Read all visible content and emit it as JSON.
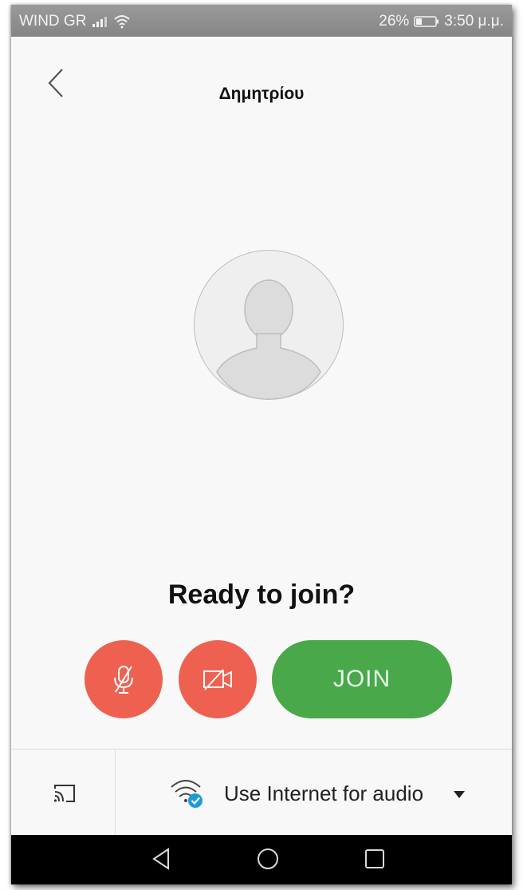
{
  "status_bar": {
    "carrier": "WIND GR",
    "battery_percent": "26%",
    "time": "3:50 μ.μ."
  },
  "header": {
    "title": "Δημητρίου",
    "back_icon": "chevron-left-icon"
  },
  "avatar": {
    "icon": "person-silhouette-icon"
  },
  "main": {
    "heading": "Ready to join?",
    "mute_icon": "microphone-off-icon",
    "video_icon": "video-off-icon",
    "join_label": "JOIN"
  },
  "bottom_bar": {
    "cast_icon": "cast-icon",
    "audio_icon": "wifi-check-icon",
    "audio_label": "Use Internet for audio",
    "dropdown_icon": "caret-down-icon"
  },
  "nav_bar": {
    "back": "triangle-back-icon",
    "home": "circle-home-icon",
    "recents": "square-recents-icon"
  },
  "colors": {
    "mute_red": "#ee6150",
    "join_green": "#48a84a",
    "accent_blue": "#1f9ad6",
    "status_gray": "#8f8f8f"
  }
}
